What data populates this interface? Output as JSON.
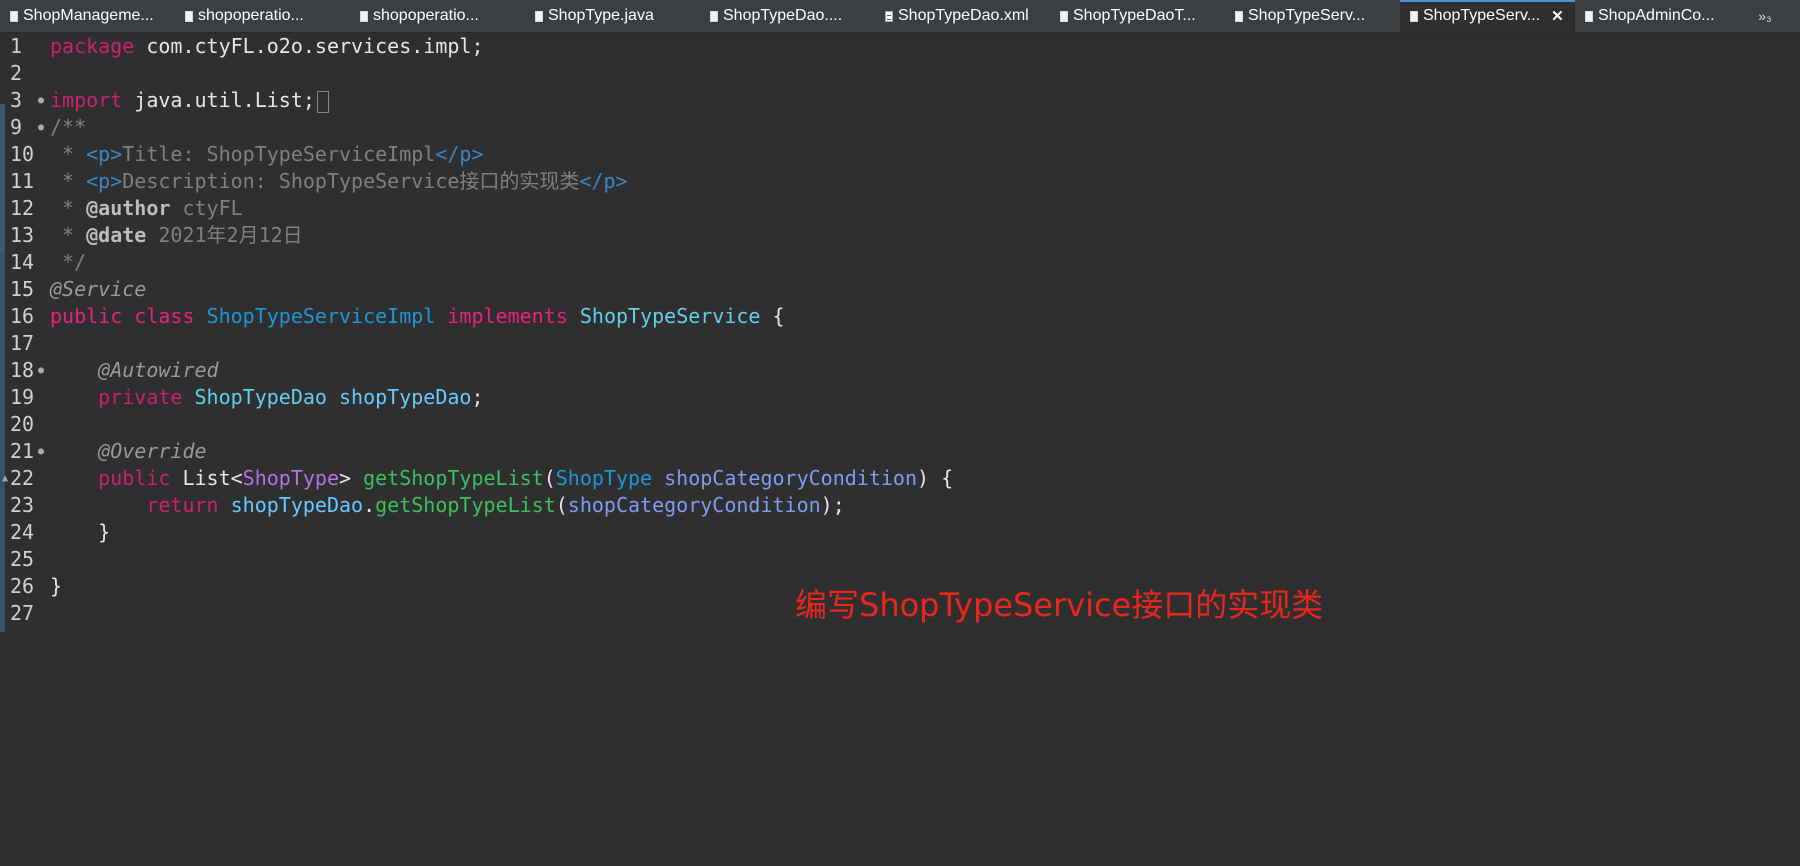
{
  "tabs": [
    {
      "label": "ShopManageme...",
      "icon": "java-file-icon",
      "active": false
    },
    {
      "label": "shopoperatio...",
      "icon": "java-file-icon",
      "active": false
    },
    {
      "label": "shopoperatio...",
      "icon": "java-file-icon",
      "active": false
    },
    {
      "label": "ShopType.java",
      "icon": "java-file-icon",
      "active": false
    },
    {
      "label": "ShopTypeDao....",
      "icon": "java-file-icon",
      "active": false
    },
    {
      "label": "ShopTypeDao.xml",
      "icon": "xml-file-icon",
      "active": false
    },
    {
      "label": "ShopTypeDaoT...",
      "icon": "java-file-icon",
      "active": false
    },
    {
      "label": "ShopTypeServ...",
      "icon": "java-file-icon",
      "active": false
    },
    {
      "label": "ShopTypeServ...",
      "icon": "java-file-icon",
      "active": true
    },
    {
      "label": "ShopAdminCo...",
      "icon": "java-file-icon",
      "active": false
    }
  ],
  "overflow_label": "»₃",
  "close_glyph": "✕",
  "lines": [
    {
      "n": "1",
      "tokens": [
        [
          "kw",
          "package"
        ],
        [
          "plain",
          " com.ctyFL.o2o.services.impl;"
        ]
      ]
    },
    {
      "n": "2",
      "tokens": []
    },
    {
      "n": "3",
      "fold": true,
      "tokens": [
        [
          "kw",
          "import"
        ],
        [
          "plain",
          " java.util.List;"
        ]
      ]
    },
    {
      "n": "9",
      "fold": true,
      "tokens": [
        [
          "cmt",
          "/**"
        ]
      ]
    },
    {
      "n": "10",
      "tokens": [
        [
          "cmt",
          " * "
        ],
        [
          "tag",
          "<p>"
        ],
        [
          "cmt",
          "Title: ShopTypeServiceImpl"
        ],
        [
          "tag",
          "</p>"
        ]
      ]
    },
    {
      "n": "11",
      "tokens": [
        [
          "cmt",
          " * "
        ],
        [
          "tag",
          "<p>"
        ],
        [
          "cmt",
          "Description: ShopTypeService接口的实现类"
        ],
        [
          "tag",
          "</p>"
        ]
      ]
    },
    {
      "n": "12",
      "tokens": [
        [
          "cmt",
          " * "
        ],
        [
          "jdoc",
          "@author"
        ],
        [
          "cmt",
          " ctyFL"
        ]
      ]
    },
    {
      "n": "13",
      "tokens": [
        [
          "cmt",
          " * "
        ],
        [
          "jdoc",
          "@date"
        ],
        [
          "cmt",
          " 2021年2月12日"
        ]
      ]
    },
    {
      "n": "14",
      "tokens": [
        [
          "cmt",
          " */"
        ]
      ]
    },
    {
      "n": "15",
      "tokens": [
        [
          "anno",
          "@Service"
        ]
      ]
    },
    {
      "n": "16",
      "tokens": [
        [
          "kw2",
          "public"
        ],
        [
          "plain",
          " "
        ],
        [
          "kw2",
          "class"
        ],
        [
          "plain",
          " "
        ],
        [
          "cls",
          "ShopTypeServiceImpl"
        ],
        [
          "plain",
          " "
        ],
        [
          "kw2",
          "implements"
        ],
        [
          "plain",
          " "
        ],
        [
          "iface",
          "ShopTypeService"
        ],
        [
          "plain",
          " {"
        ]
      ]
    },
    {
      "n": "17",
      "tokens": []
    },
    {
      "n": "18",
      "fold": true,
      "tokens": [
        [
          "plain",
          "    "
        ],
        [
          "anno",
          "@Autowired"
        ]
      ]
    },
    {
      "n": "19",
      "tokens": [
        [
          "plain",
          "    "
        ],
        [
          "kw",
          "private"
        ],
        [
          "plain",
          " "
        ],
        [
          "iface",
          "ShopTypeDao"
        ],
        [
          "plain",
          " "
        ],
        [
          "field",
          "shopTypeDao"
        ],
        [
          "plain",
          ";"
        ]
      ]
    },
    {
      "n": "20",
      "tokens": []
    },
    {
      "n": "21",
      "fold": true,
      "tokens": [
        [
          "plain",
          "    "
        ],
        [
          "anno",
          "@Override"
        ]
      ]
    },
    {
      "n": "22",
      "override": true,
      "tokens": [
        [
          "plain",
          "    "
        ],
        [
          "kw",
          "public"
        ],
        [
          "plain",
          " List<"
        ],
        [
          "generic",
          "ShopType"
        ],
        [
          "plain",
          "> "
        ],
        [
          "meth",
          "getShopTypeList"
        ],
        [
          "plain",
          "("
        ],
        [
          "cls",
          "ShopType"
        ],
        [
          "plain",
          " "
        ],
        [
          "param",
          "shopCategoryCondition"
        ],
        [
          "plain",
          ") {"
        ]
      ]
    },
    {
      "n": "23",
      "tokens": [
        [
          "plain",
          "        "
        ],
        [
          "kw",
          "return"
        ],
        [
          "plain",
          " "
        ],
        [
          "field",
          "shopTypeDao"
        ],
        [
          "plain",
          "."
        ],
        [
          "meth",
          "getShopTypeList"
        ],
        [
          "plain",
          "("
        ],
        [
          "param",
          "shopCategoryCondition"
        ],
        [
          "plain",
          ");"
        ]
      ]
    },
    {
      "n": "24",
      "tokens": [
        [
          "plain",
          "    }"
        ]
      ]
    },
    {
      "n": "25",
      "tokens": []
    },
    {
      "n": "26",
      "tokens": [
        [
          "plain",
          "}"
        ]
      ]
    },
    {
      "n": "27",
      "tokens": []
    }
  ],
  "annotation_text": "编写ShopTypeService接口的实现类"
}
